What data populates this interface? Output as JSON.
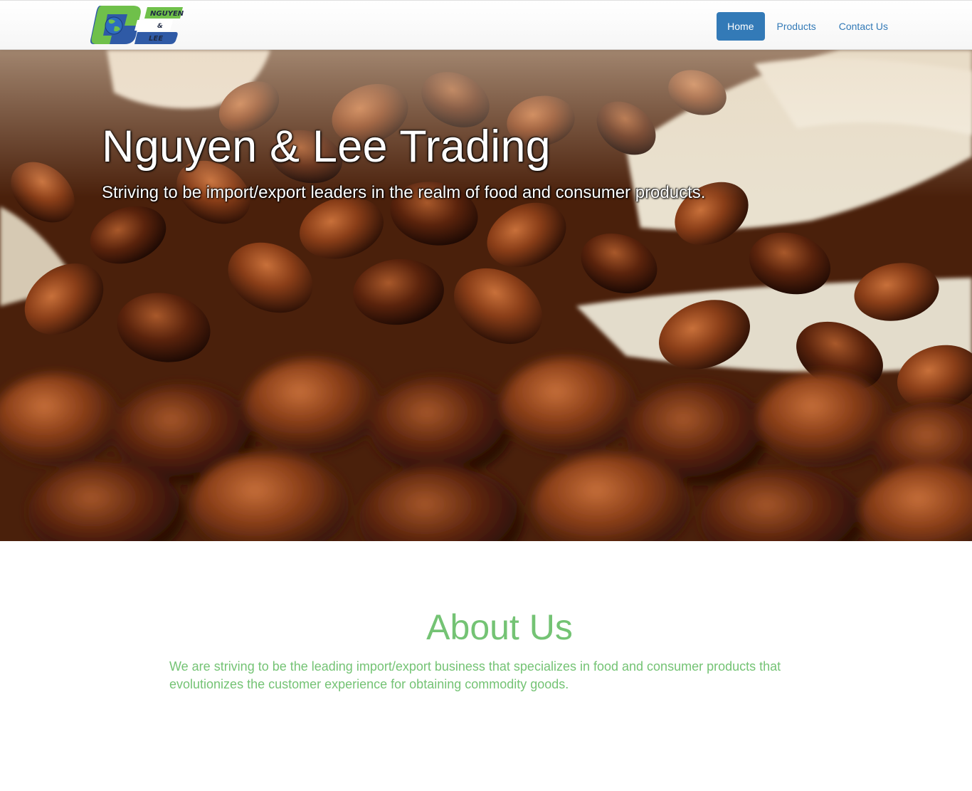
{
  "navbar": {
    "logo": {
      "icon": "globe-logo-icon",
      "lettering": [
        "NGUYEN",
        "&",
        "LEE"
      ],
      "colors": {
        "green": "#6fc04a",
        "blue": "#2f5aa6",
        "navy": "#1f2a44"
      }
    },
    "links": [
      {
        "label": "Home",
        "active": true
      },
      {
        "label": "Products",
        "active": false
      },
      {
        "label": "Contact Us",
        "active": false
      }
    ]
  },
  "hero": {
    "title": "Nguyen & Lee Trading",
    "subtitle": "Striving to be import/export leaders in the realm of food and consumer products."
  },
  "about": {
    "title": "About Us",
    "text": "We are striving to be the leading import/export business that specializes in food and consumer products that evolutionizes the customer experience for obtaining commodity goods."
  },
  "colors": {
    "nav_active": "#337ab7",
    "link": "#337ab7",
    "about_green": "#74c374"
  }
}
